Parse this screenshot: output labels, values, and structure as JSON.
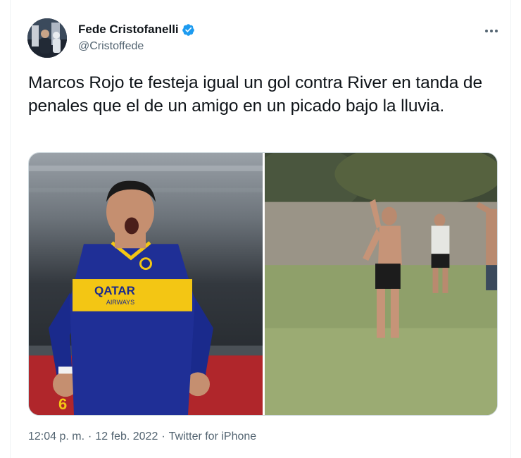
{
  "author": {
    "display_name": "Fede Cristofanelli",
    "handle": "@Cristoffede",
    "verified": true
  },
  "tweet": {
    "text": "Marcos Rojo te festeja igual un gol contra River en tanda de penales que el de un amigo en un picado bajo la lluvia."
  },
  "media": {
    "left_photo": {
      "shirt_sponsor_line1": "QATAR",
      "shirt_sponsor_line2": "AIRWAYS",
      "shirt_number": "6"
    }
  },
  "meta": {
    "time": "12:04 p. m.",
    "separator1": "·",
    "date": "12 feb. 2022",
    "separator2": "·",
    "source": "Twitter for iPhone"
  },
  "colors": {
    "verified_blue": "#1d9bf0",
    "boca_blue": "#1a2a8c",
    "boca_gold": "#f3c614",
    "text_secondary": "#536471"
  },
  "icons": {
    "verified": "verified-badge-icon",
    "more": "more-options-icon"
  }
}
